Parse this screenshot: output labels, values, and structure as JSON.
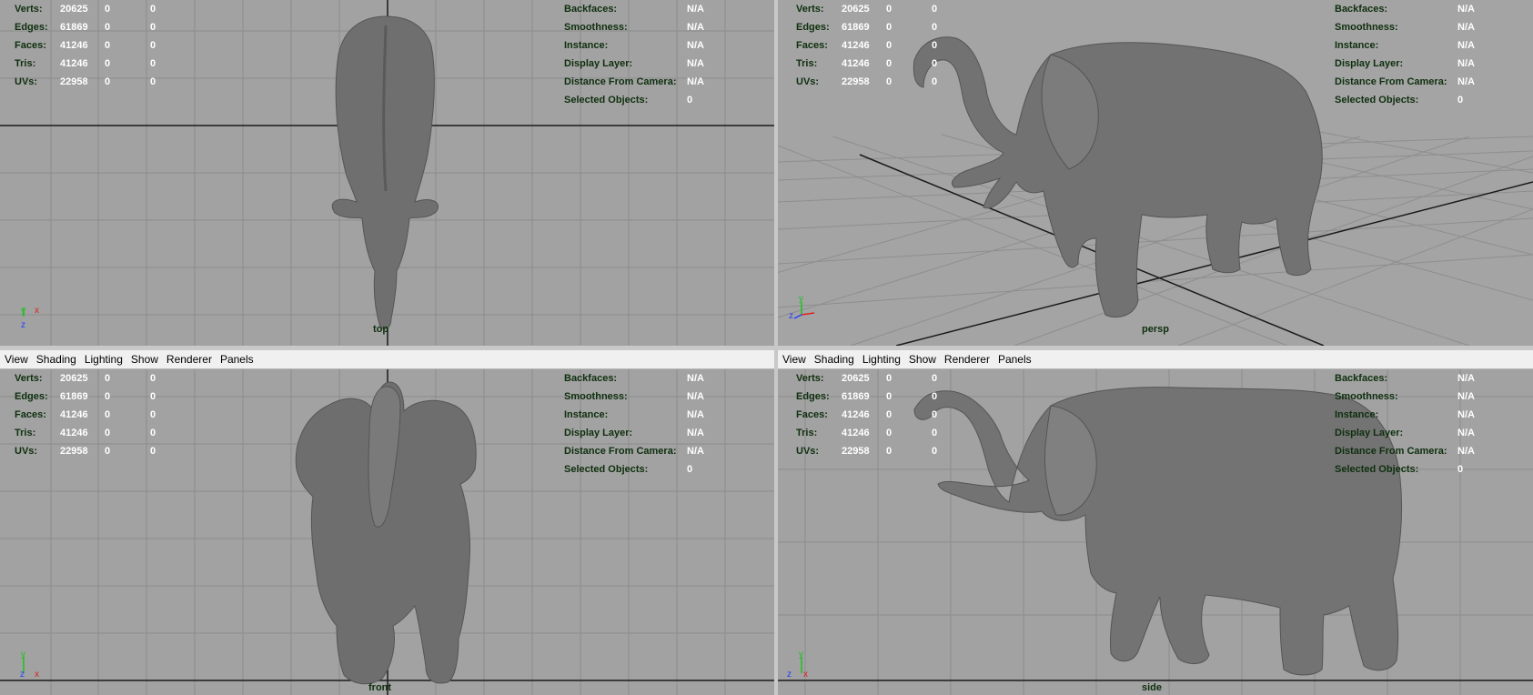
{
  "menu": [
    "View",
    "Shading",
    "Lighting",
    "Show",
    "Renderer",
    "Panels"
  ],
  "hud_left": [
    {
      "label": "Verts:",
      "values": [
        "20625",
        "0",
        "0"
      ]
    },
    {
      "label": "Edges:",
      "values": [
        "61869",
        "0",
        "0"
      ]
    },
    {
      "label": "Faces:",
      "values": [
        "41246",
        "0",
        "0"
      ]
    },
    {
      "label": "Tris:",
      "values": [
        "41246",
        "0",
        "0"
      ]
    },
    {
      "label": "UVs:",
      "values": [
        "22958",
        "0",
        "0"
      ]
    }
  ],
  "hud_right": [
    {
      "label": "Backfaces:",
      "value": "N/A"
    },
    {
      "label": "Smoothness:",
      "value": "N/A"
    },
    {
      "label": "Instance:",
      "value": "N/A"
    },
    {
      "label": "Display Layer:",
      "value": "N/A"
    },
    {
      "label": "Distance From Camera:",
      "value": "N/A"
    },
    {
      "label": "Selected Objects:",
      "value": "0"
    }
  ],
  "viewports": {
    "top": {
      "camera": "top"
    },
    "persp": {
      "camera": "persp"
    },
    "front": {
      "camera": "front"
    },
    "side": {
      "camera": "side"
    }
  },
  "axes": {
    "x": "x",
    "y": "y",
    "z": "z"
  },
  "colors": {
    "viewport_bg": "#a2a2a2",
    "hud_label": "#0e2f0e",
    "hud_value": "#ffffff",
    "grid": "#8a8a8a",
    "grid_axis": "#1a1a1a",
    "model": "#6e6e6e",
    "axis_x": "#e02020",
    "axis_y": "#20c020",
    "axis_z": "#2040ff"
  }
}
